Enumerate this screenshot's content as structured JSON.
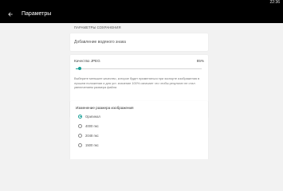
{
  "status_bar": {
    "time": "22:36"
  },
  "app_bar": {
    "back_icon": "arrow-back-icon",
    "title": "Параметры"
  },
  "section": {
    "title": "ПАРАМЕТРЫ СОХРАНЕНИЯ"
  },
  "watermark": {
    "label": "Добавление водяного знака"
  },
  "quality": {
    "label": "Качество JPEG",
    "value_text": "85%",
    "level_percent": 3,
    "accent_color": "#1aa197",
    "description": "Выберите меньшее качество, которое будет применяться при экспорте изображения в лучшем положении и для уст. значение 100% означает что чтобы результат не стал увеличением размера файла"
  },
  "resize": {
    "title": "Изменение размера изображения",
    "options": [
      {
        "label": "Оригинал",
        "checked": true
      },
      {
        "label": "4000 пкс",
        "checked": false
      },
      {
        "label": "2048 пкс",
        "checked": false
      },
      {
        "label": "1500 пкс",
        "checked": false
      }
    ]
  }
}
